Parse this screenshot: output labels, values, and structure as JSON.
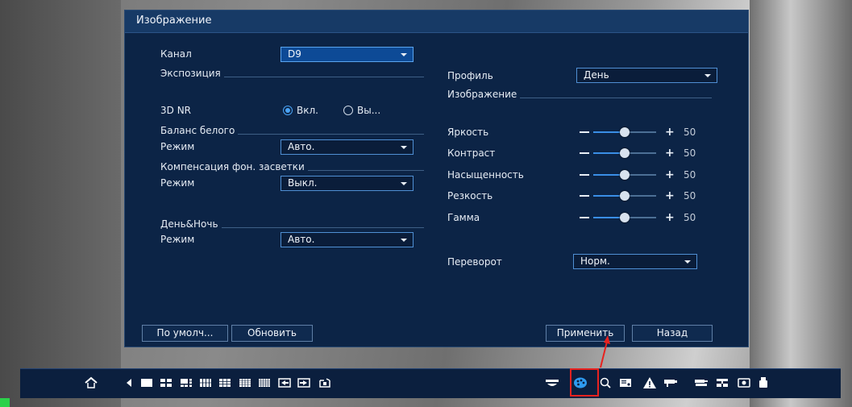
{
  "dialog": {
    "title": "Изображение",
    "channel": {
      "label": "Канал",
      "value": "D9"
    },
    "exposure_section": "Экспозиция",
    "nr3d": {
      "label": "3D NR",
      "on_label": "Вкл.",
      "off_label": "Вы...",
      "selected": "on"
    },
    "white_balance": {
      "section": "Баланс белого",
      "mode_label": "Режим",
      "mode_value": "Авто."
    },
    "backlight": {
      "section": "Компенсация фон. засветки",
      "mode_label": "Режим",
      "mode_value": "Выкл."
    },
    "daynight": {
      "section": "День&Ночь",
      "mode_label": "Режим",
      "mode_value": "Авто."
    },
    "profile": {
      "label": "Профиль",
      "value": "День"
    },
    "image_section": "Изображение",
    "sliders": [
      {
        "label": "Яркость",
        "value": 50,
        "fraction": 0.5
      },
      {
        "label": "Контраст",
        "value": 50,
        "fraction": 0.5
      },
      {
        "label": "Насыщенность",
        "value": 50,
        "fraction": 0.5
      },
      {
        "label": "Резкость",
        "value": 50,
        "fraction": 0.5
      },
      {
        "label": "Гамма",
        "value": 50,
        "fraction": 0.5
      }
    ],
    "flip": {
      "label": "Переворот",
      "value": "Норм."
    },
    "buttons": {
      "default": "По умолч...",
      "refresh": "Обновить",
      "apply": "Применить",
      "back": "Назад"
    }
  },
  "taskbar": {
    "icons": [
      "home-icon",
      "prev-icon",
      "layout-1-icon",
      "layout-4-icon",
      "layout-6-icon",
      "layout-8-icon",
      "layout-9-icon",
      "layout-16-icon",
      "layout-25-icon",
      "prev-group-icon",
      "next-group-icon",
      "sequence-icon",
      "ptz-icon",
      "color-icon",
      "search-icon",
      "record-icon",
      "alarm-icon",
      "camera-icon",
      "device-icon",
      "network-icon",
      "hdd-icon",
      "usb-icon"
    ],
    "highlighted": "color-icon",
    "accent_color": "#2e9bf0",
    "highlight_color": "#e8221f"
  }
}
